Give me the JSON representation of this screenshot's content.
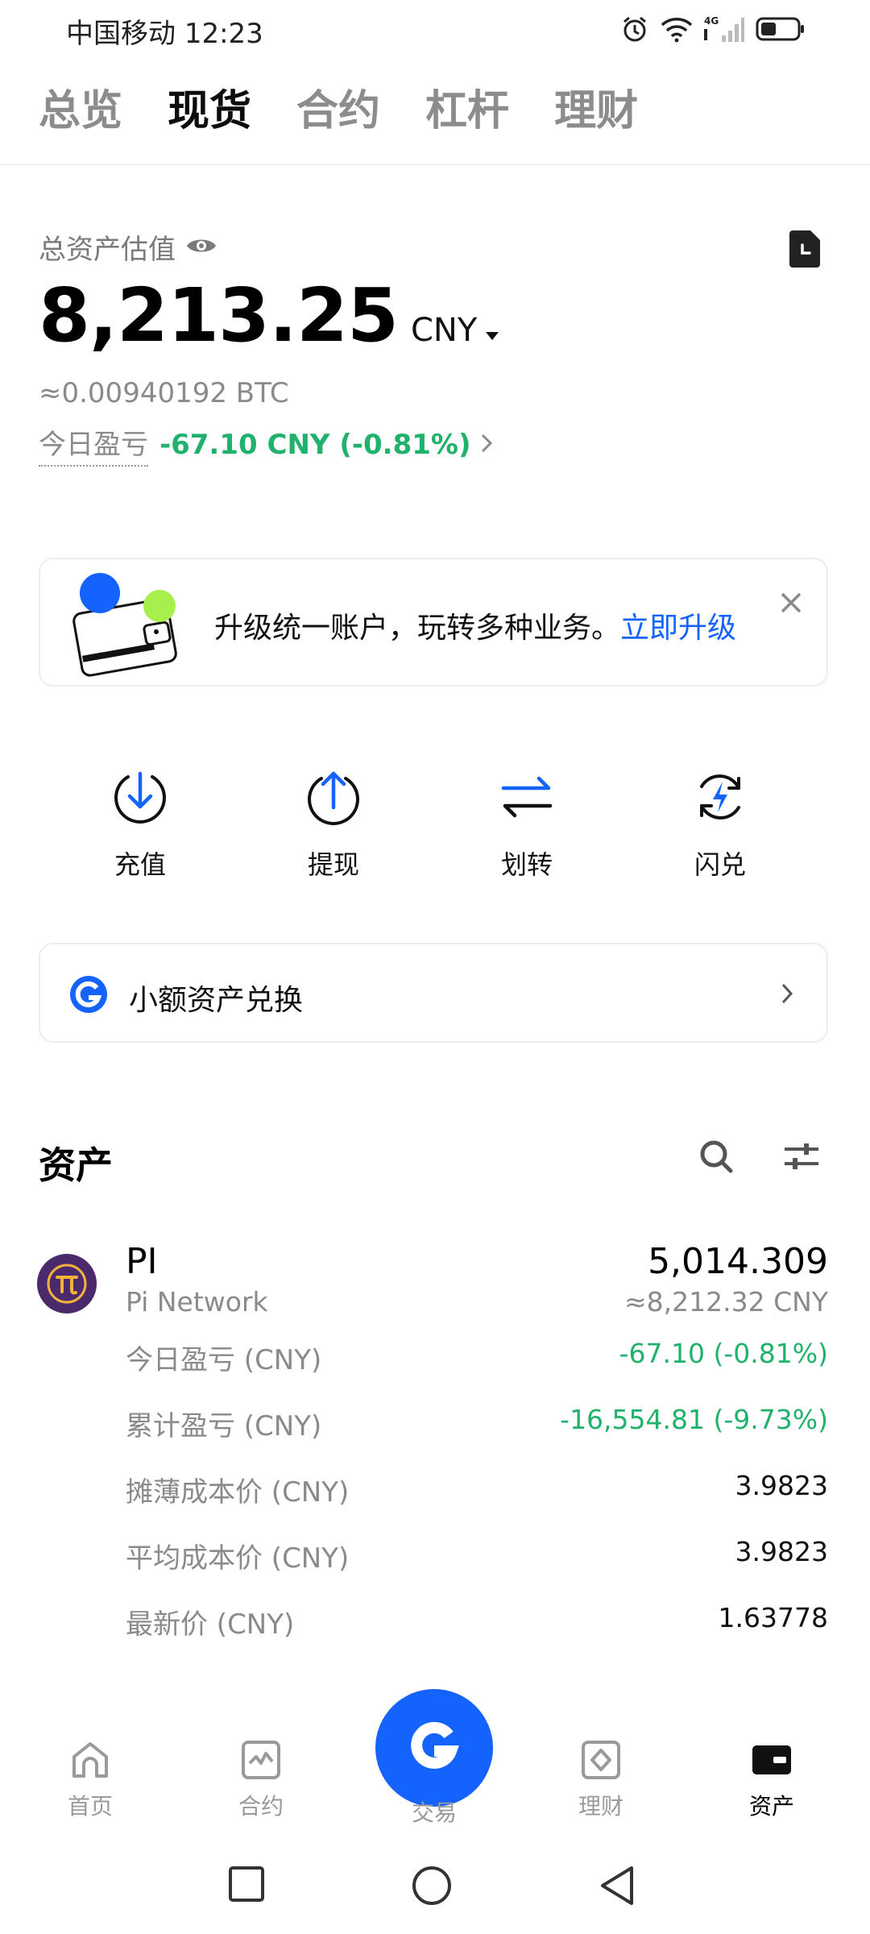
{
  "status_bar": {
    "carrier": "中国移动",
    "time": "12:23",
    "icons": [
      "alarm-icon",
      "wifi-icon",
      "4g-signal-icon",
      "battery-icon"
    ]
  },
  "top_tabs": [
    {
      "label": "总览",
      "active": false
    },
    {
      "label": "现货",
      "active": true
    },
    {
      "label": "合约",
      "active": false
    },
    {
      "label": "杠杆",
      "active": false
    },
    {
      "label": "理财",
      "active": false
    }
  ],
  "summary": {
    "label": "总资产估值",
    "amount": "8,213.25",
    "currency": "CNY",
    "btc_equivalent": "≈0.00940192 BTC",
    "pnl_label": "今日盈亏",
    "pnl_value": "-67.10 CNY (-0.81%)"
  },
  "upgrade_banner": {
    "text": "升级统一账户，玩转多种业务。",
    "link": "立即升级"
  },
  "quick_actions": [
    {
      "label": "充值",
      "icon": "deposit-icon"
    },
    {
      "label": "提现",
      "icon": "withdraw-icon"
    },
    {
      "label": "划转",
      "icon": "transfer-icon"
    },
    {
      "label": "闪兑",
      "icon": "flash-swap-icon"
    }
  ],
  "small_swap": {
    "label": "小额资产兑换"
  },
  "assets": {
    "title": "资产",
    "items": [
      {
        "symbol": "PI",
        "name": "Pi Network",
        "amount": "5,014.309",
        "value": "≈8,212.32 CNY",
        "metrics": [
          {
            "label": "今日盈亏 (CNY)",
            "value": "-67.10 (-0.81%)"
          },
          {
            "label": "累计盈亏 (CNY)",
            "value": "-16,554.81 (-9.73%)"
          },
          {
            "label": "摊薄成本价 (CNY)",
            "value": "3.9823"
          },
          {
            "label": "平均成本价 (CNY)",
            "value": "3.9823"
          },
          {
            "label": "最新价 (CNY)",
            "value": "1.63778"
          }
        ]
      }
    ]
  },
  "bottom_nav": [
    {
      "label": "首页",
      "icon": "home-icon",
      "active": false
    },
    {
      "label": "合约",
      "icon": "contract-chart-icon",
      "active": false
    },
    {
      "label": "交易",
      "icon": "trade-icon",
      "active": false
    },
    {
      "label": "理财",
      "icon": "earn-icon",
      "active": false
    },
    {
      "label": "资产",
      "icon": "wallet-icon",
      "active": true
    }
  ],
  "colors": {
    "accent": "#1463ff",
    "positive_text": "#20b26c",
    "muted_text": "#8a8a8a"
  }
}
